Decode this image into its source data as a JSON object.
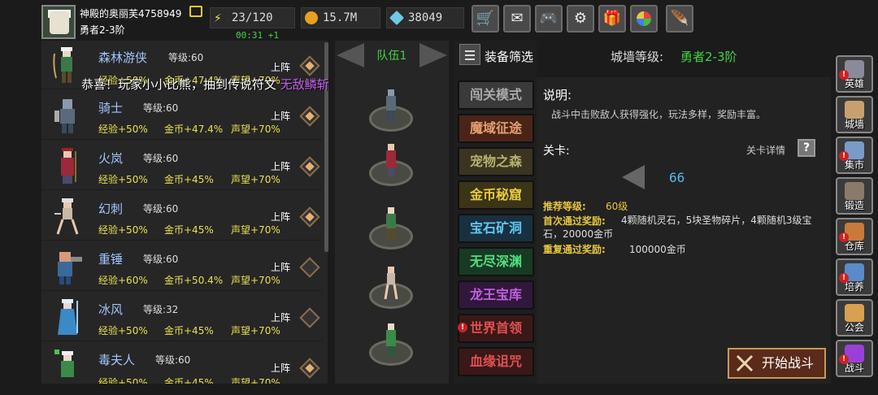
{
  "player": {
    "name": "神殿的奥丽芙4758949",
    "rank": "勇者2-3阶",
    "stamina": "23/120",
    "stamina_timer": "00:31 +1",
    "gold": "15.7M",
    "diamonds": "38049"
  },
  "toolbar_icons": [
    "shop-cart-icon",
    "mail-icon",
    "gamepad-icon",
    "settings-gear-icon",
    "gift-icon",
    "lucky-wheel-icon",
    "feather-icon"
  ],
  "notice": {
    "text": "恭喜！玩家小小比熊，抽到传说符文",
    "item": "无敌鳞斩（银刃）"
  },
  "heroes": [
    {
      "name": "森林游侠",
      "level_label": "等级:60",
      "exp": "经验+50%",
      "gold": "金币+47.4%",
      "rep": "声望+70%",
      "status": "上阵",
      "deployed": true
    },
    {
      "name": "骑士",
      "level_label": "等级:60",
      "exp": "经验+50%",
      "gold": "金币+47.4%",
      "rep": "声望+70%",
      "status": "上阵",
      "deployed": true
    },
    {
      "name": "火岚",
      "level_label": "等级:60",
      "exp": "经验+50%",
      "gold": "金币+45%",
      "rep": "声望+70%",
      "status": "上阵",
      "deployed": true
    },
    {
      "name": "幻刺",
      "level_label": "等级:60",
      "exp": "经验+50%",
      "gold": "金币+45%",
      "rep": "声望+70%",
      "status": "上阵",
      "deployed": true
    },
    {
      "name": "重锤",
      "level_label": "等级:60",
      "exp": "经验+60%",
      "gold": "金币+50.4%",
      "rep": "声望+70%",
      "status": "上阵",
      "deployed": false
    },
    {
      "name": "冰风",
      "level_label": "等级:32",
      "exp": "经验+50%",
      "gold": "金币+45%",
      "rep": "声望+70%",
      "status": "上阵",
      "deployed": false
    },
    {
      "name": "毒夫人",
      "level_label": "等级:60",
      "exp": "经验+50%",
      "gold": "金币+45%",
      "rep": "声望+70%",
      "status": "上阵",
      "deployed": true
    }
  ],
  "team": {
    "label": "队伍1"
  },
  "equip_filter": "装备筛选",
  "wall_level": {
    "label": "城墙等级:",
    "value": "勇者2-3阶"
  },
  "modes": [
    {
      "label": "闯关模式",
      "color": "#aaaaaa",
      "bg": "#3a3a3a",
      "alert": false
    },
    {
      "label": "魔域征途",
      "color": "#e8a070",
      "bg": "#4a2418",
      "alert": false
    },
    {
      "label": "宠物之森",
      "color": "#b8b070",
      "bg": "#3a3420",
      "alert": false
    },
    {
      "label": "金币秘窟",
      "color": "#e8c840",
      "bg": "#3a3418",
      "alert": false
    },
    {
      "label": "宝石矿洞",
      "color": "#60c8f0",
      "bg": "#183040",
      "alert": false
    },
    {
      "label": "无尽深渊",
      "color": "#50e080",
      "bg": "#183a24",
      "alert": false
    },
    {
      "label": "龙王宝库",
      "color": "#c060e0",
      "bg": "#30183a",
      "alert": false
    },
    {
      "label": "世界首领",
      "color": "#e05050",
      "bg": "#3a1818",
      "alert": true
    },
    {
      "label": "血缘诅咒",
      "color": "#e05050",
      "bg": "#3a1818",
      "alert": false
    }
  ],
  "info": {
    "desc_title": "说明:",
    "desc": "战斗中击败敌人获得强化，玩法多样，奖励丰富。",
    "stage_title": "关卡:",
    "stage_detail": "关卡详情",
    "stage_number": "66",
    "recommend_label": "推荐等级:",
    "recommend_value": "60级",
    "first_label": "首次通过奖励:",
    "first_value": "4颗随机灵石，5块圣物碎片，4颗随机3级宝石，20000金币",
    "repeat_label": "重复通过奖励:",
    "repeat_value": "100000金币",
    "start_button": "开始战斗"
  },
  "nav": [
    {
      "label": "英雄",
      "icon": "hero-helmet-icon",
      "alert": true
    },
    {
      "label": "城墙",
      "icon": "castle-wall-icon",
      "alert": false
    },
    {
      "label": "集市",
      "icon": "market-stall-icon",
      "alert": true
    },
    {
      "label": "锻造",
      "icon": "anvil-icon",
      "alert": false
    },
    {
      "label": "仓库",
      "icon": "chest-icon",
      "alert": true
    },
    {
      "label": "培养",
      "icon": "training-icon",
      "alert": true
    },
    {
      "label": "公会",
      "icon": "guild-icon",
      "alert": false
    },
    {
      "label": "战斗",
      "icon": "battle-portal-icon",
      "alert": true
    }
  ]
}
